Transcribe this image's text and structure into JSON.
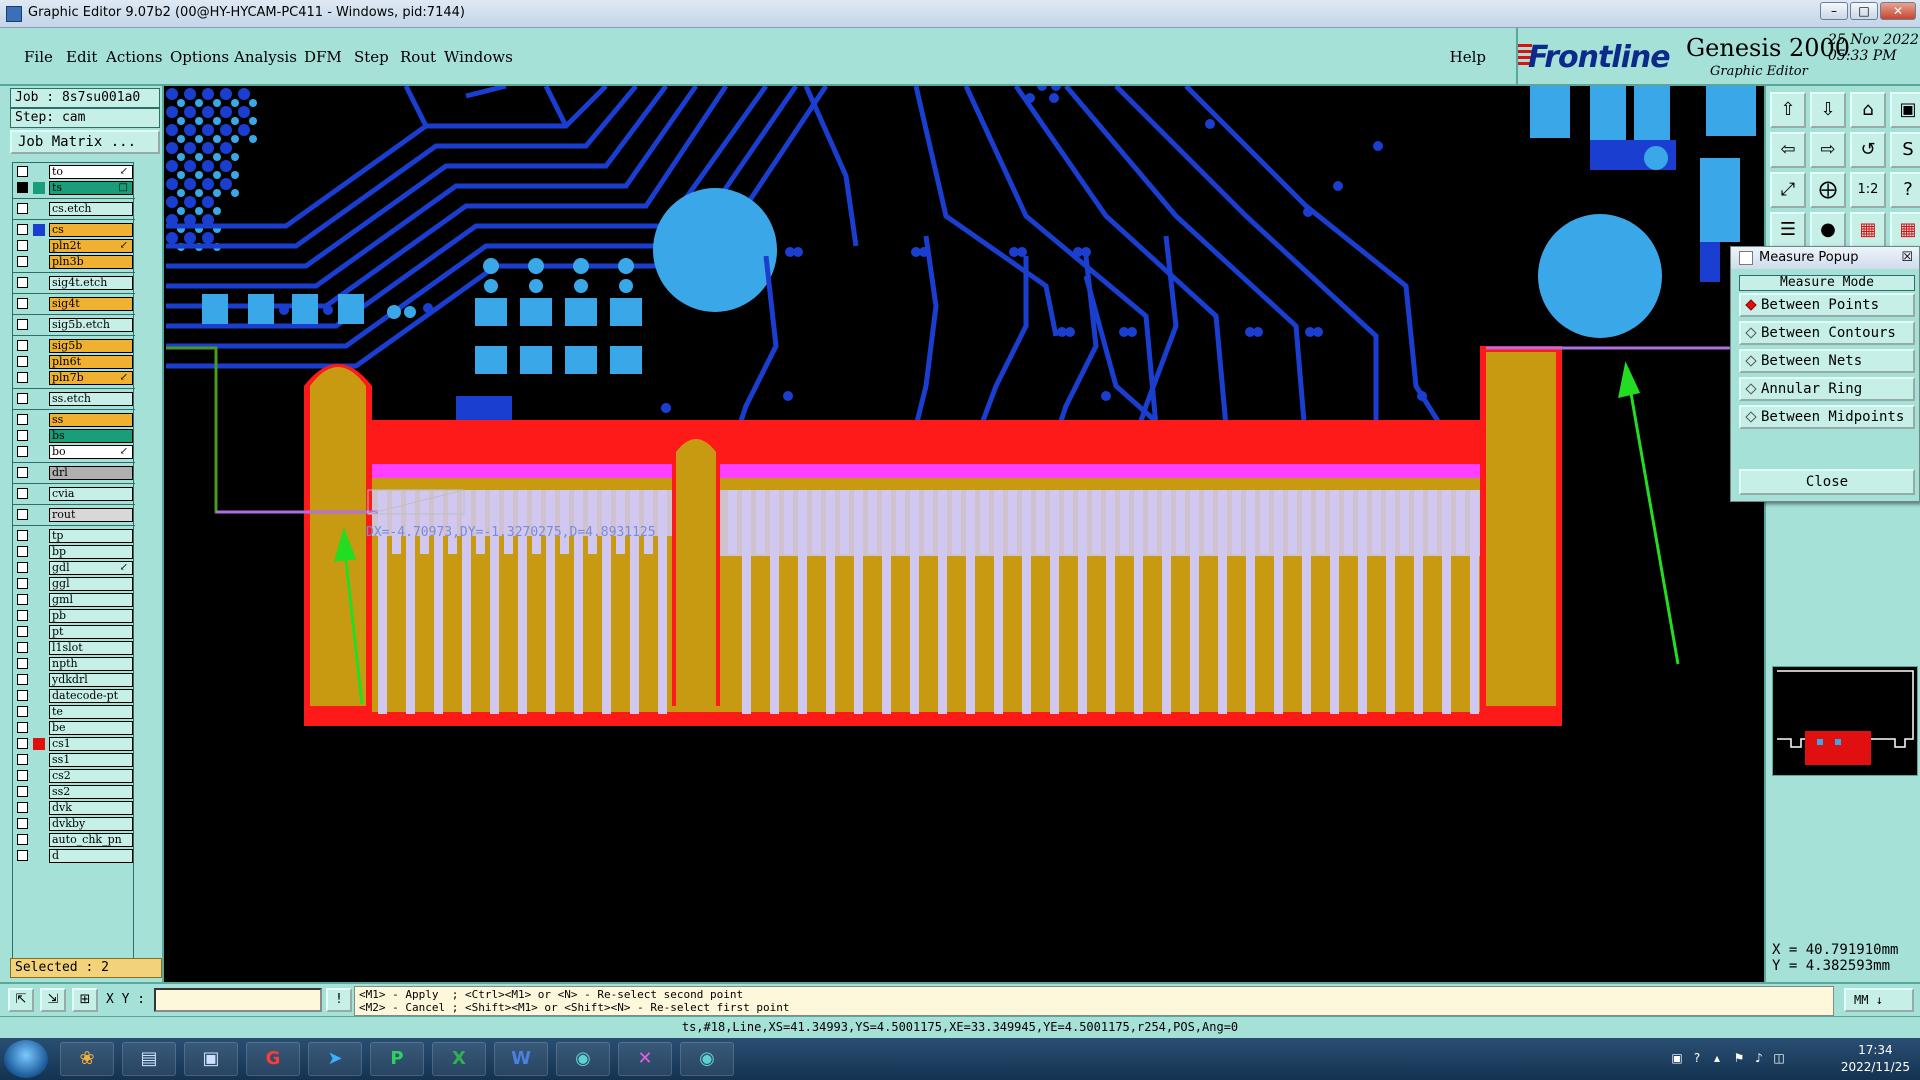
{
  "window": {
    "title": "Graphic Editor 9.07b2 (00@HY-HYCAM-PC411 - Windows, pid:7144)",
    "minimize": "–",
    "maximize": "□",
    "close": "✕"
  },
  "menu": {
    "items": [
      "File",
      "Edit",
      "Actions",
      "Options",
      "Analysis",
      "DFM",
      "Step",
      "Rout",
      "Windows"
    ],
    "help": "Help"
  },
  "brand": {
    "logo": "Frontline",
    "product": "Genesis 2000",
    "subtitle": "Graphic Editor",
    "date": "25 Nov 2022",
    "time": "05:33 PM"
  },
  "job": {
    "job_label": "Job : 8s7su001a0",
    "step_label": "Step: cam",
    "matrix_button": "Job Matrix ..."
  },
  "layers": [
    {
      "name": "to",
      "color": "#ffffff",
      "checked": false,
      "swatch": "",
      "mark": "↙"
    },
    {
      "name": "ts",
      "color": "#1a9e7a",
      "checked": true,
      "swatch": "#1a9e7a",
      "mark": "□"
    },
    {
      "name": "cs.etch",
      "color": "#c6efe8",
      "checked": false,
      "swatch": "",
      "mark": ""
    },
    {
      "name": "cs",
      "color": "#f0b030",
      "checked": false,
      "swatch": "#1a3fd0",
      "mark": ""
    },
    {
      "name": "pln2t",
      "color": "#f0b030",
      "checked": false,
      "swatch": "",
      "mark": "↙"
    },
    {
      "name": "pln3b",
      "color": "#f0b030",
      "checked": false,
      "swatch": "",
      "mark": ""
    },
    {
      "name": "sig4t.etch",
      "color": "#c6efe8",
      "checked": false,
      "swatch": "",
      "mark": ""
    },
    {
      "name": "sig4t",
      "color": "#f0b030",
      "checked": false,
      "swatch": "",
      "mark": ""
    },
    {
      "name": "sig5b.etch",
      "color": "#c6efe8",
      "checked": false,
      "swatch": "",
      "mark": ""
    },
    {
      "name": "sig5b",
      "color": "#f0b030",
      "checked": false,
      "swatch": "",
      "mark": ""
    },
    {
      "name": "pln6t",
      "color": "#f0b030",
      "checked": false,
      "swatch": "",
      "mark": ""
    },
    {
      "name": "pln7b",
      "color": "#f0b030",
      "checked": false,
      "swatch": "",
      "mark": "↙"
    },
    {
      "name": "ss.etch",
      "color": "#c6efe8",
      "checked": false,
      "swatch": "",
      "mark": ""
    },
    {
      "name": "ss",
      "color": "#f0b030",
      "checked": false,
      "swatch": "",
      "mark": ""
    },
    {
      "name": "bs",
      "color": "#1a9e7a",
      "checked": false,
      "swatch": "",
      "mark": ""
    },
    {
      "name": "bo",
      "color": "#ffffff",
      "checked": false,
      "swatch": "",
      "mark": "↙"
    },
    {
      "name": "drl",
      "color": "#b0b0b0",
      "checked": false,
      "swatch": "",
      "mark": ""
    },
    {
      "name": "cvia",
      "color": "#c6efe8",
      "checked": false,
      "swatch": "",
      "mark": ""
    },
    {
      "name": "rout",
      "color": "#d8d8d8",
      "checked": false,
      "swatch": "",
      "mark": ""
    },
    {
      "name": "tp",
      "color": "#c6efe8",
      "checked": false,
      "swatch": "",
      "mark": ""
    },
    {
      "name": "bp",
      "color": "#c6efe8",
      "checked": false,
      "swatch": "",
      "mark": ""
    },
    {
      "name": "gdl",
      "color": "#c6efe8",
      "checked": false,
      "swatch": "",
      "mark": "↙"
    },
    {
      "name": "ggl",
      "color": "#c6efe8",
      "checked": false,
      "swatch": "",
      "mark": ""
    },
    {
      "name": "gml",
      "color": "#c6efe8",
      "checked": false,
      "swatch": "",
      "mark": ""
    },
    {
      "name": "pb",
      "color": "#c6efe8",
      "checked": false,
      "swatch": "",
      "mark": ""
    },
    {
      "name": "pt",
      "color": "#c6efe8",
      "checked": false,
      "swatch": "",
      "mark": ""
    },
    {
      "name": "l1slot",
      "color": "#c6efe8",
      "checked": false,
      "swatch": "",
      "mark": ""
    },
    {
      "name": "npth",
      "color": "#c6efe8",
      "checked": false,
      "swatch": "",
      "mark": ""
    },
    {
      "name": "ydkdrl",
      "color": "#c6efe8",
      "checked": false,
      "swatch": "",
      "mark": ""
    },
    {
      "name": "datecode-pt",
      "color": "#c6efe8",
      "checked": false,
      "swatch": "",
      "mark": ""
    },
    {
      "name": "te",
      "color": "#c6efe8",
      "checked": false,
      "swatch": "",
      "mark": ""
    },
    {
      "name": "be",
      "color": "#c6efe8",
      "checked": false,
      "swatch": "",
      "mark": ""
    },
    {
      "name": "cs1",
      "color": "#c6efe8",
      "checked": false,
      "swatch": "#e01010",
      "mark": ""
    },
    {
      "name": "ss1",
      "color": "#c6efe8",
      "checked": false,
      "swatch": "",
      "mark": ""
    },
    {
      "name": "cs2",
      "color": "#c6efe8",
      "checked": false,
      "swatch": "",
      "mark": ""
    },
    {
      "name": "ss2",
      "color": "#c6efe8",
      "checked": false,
      "swatch": "",
      "mark": ""
    },
    {
      "name": "dvk",
      "color": "#c6efe8",
      "checked": false,
      "swatch": "",
      "mark": ""
    },
    {
      "name": "dvkby",
      "color": "#c6efe8",
      "checked": false,
      "swatch": "",
      "mark": ""
    },
    {
      "name": "auto_chk_pn",
      "color": "#c6efe8",
      "checked": false,
      "swatch": "",
      "mark": ""
    },
    {
      "name": "d",
      "color": "#c6efe8",
      "checked": false,
      "swatch": "",
      "mark": ""
    }
  ],
  "selected": "Selected : 2",
  "measure_popup": {
    "title": "Measure Popup",
    "close_x": "☒",
    "mode_title": "Measure Mode",
    "options": [
      {
        "label": "Between Points",
        "active": true
      },
      {
        "label": "Between Contours",
        "active": false
      },
      {
        "label": "Between Nets",
        "active": false
      },
      {
        "label": "Annular Ring",
        "active": false
      },
      {
        "label": "Between Midpoints",
        "active": false
      }
    ],
    "close_button": "Close"
  },
  "canvas": {
    "measure_readout": "DX=-4.70973,DY=-1.3270275,D=4.8931125"
  },
  "coords": {
    "x": "X = 40.791910mm",
    "y": "Y = 4.382593mm"
  },
  "command": {
    "xy_label": "X Y :",
    "xy_value": "",
    "hint_line1": "<M1> - Apply  ; <Ctrl><M1> or <N> - Re-select second point",
    "hint_line2": "<M2> - Cancel ; <Shift><M1> or <Shift><N> - Re-select first point",
    "unit": "MM"
  },
  "status": "ts,#18,Line,XS=41.34993,YS=4.5001175,XE=33.349945,YE=4.5001175,r254,POS,Ang=0",
  "taskbar": {
    "time": "17:34",
    "date": "2022/11/25"
  },
  "colors": {
    "panel": "#a6e1d8",
    "copper_red": "#ff1a1a",
    "pad_gold": "#c89a12",
    "trace_blue": "#1a3fd0",
    "pad_cyan": "#3aa8e8",
    "measure_line": "#b070e0",
    "arrow_green": "#22dd22"
  }
}
